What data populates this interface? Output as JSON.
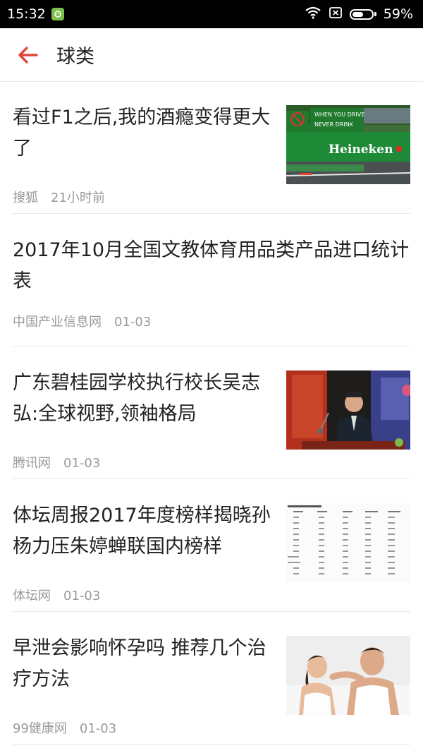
{
  "status": {
    "time": "15:32",
    "battery": "59%",
    "battery_level": 0.59,
    "icons": [
      "wifi-icon",
      "sim-none-icon",
      "battery-icon"
    ]
  },
  "header": {
    "title": "球类",
    "back_icon": "arrow-left-icon",
    "accent": "#e2453c"
  },
  "articles": [
    {
      "title": "看过F1之后,我的酒瘾变得更大了",
      "source": "搜狐",
      "time": "21小时前",
      "image": "heineken-f1-photo"
    },
    {
      "title": "2017年10月全国文教体育用品类产品进口统计表",
      "source": "中国产业信息网",
      "time": "01-03",
      "image": null
    },
    {
      "title": "广东碧桂园学校执行校长吴志弘:全球视野,领袖格局",
      "source": "腾讯网",
      "time": "01-03",
      "image": "speaker-podium-photo"
    },
    {
      "title": "体坛周报2017年度榜样揭晓孙杨力压朱婷蝉联国内榜样",
      "source": "体坛网",
      "time": "01-03",
      "image": "vote-table-photo"
    },
    {
      "title": "早泄会影响怀孕吗 推荐几个治疗方法",
      "source": "99健康网",
      "time": "01-03",
      "image": "couple-bed-photo"
    }
  ]
}
